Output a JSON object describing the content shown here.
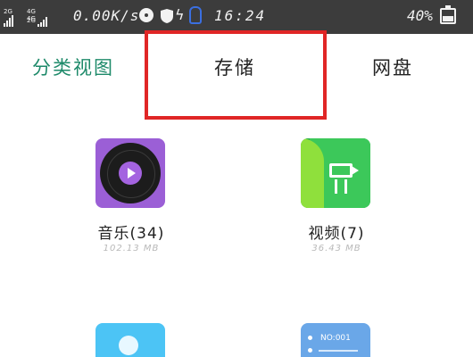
{
  "status_bar": {
    "network_1": "2G",
    "network_2a": "4G 4G",
    "network_2b": "2G",
    "speed": "0.00K/s",
    "time": "16:24",
    "battery": "40%"
  },
  "tabs": [
    {
      "label": "分类视图"
    },
    {
      "label": "存储"
    },
    {
      "label": "网盘"
    }
  ],
  "items": {
    "music": {
      "label": "音乐(34)",
      "size": "102.13 MB"
    },
    "video": {
      "label": "视频(7)",
      "size": "36.43 MB"
    },
    "document": {
      "badge": "NO:001"
    }
  },
  "colors": {
    "active_tab": "#1e8a6a",
    "highlight": "#e02626",
    "status_bar": "#3c3c3c",
    "music_icon": "#9b5fd6",
    "video_icon": "#2db04b"
  },
  "icons": [
    "signal-icon",
    "disc-icon",
    "shield-icon",
    "bolt-icon",
    "bell-icon",
    "battery-icon",
    "music-app-icon",
    "video-app-icon",
    "photo-app-icon",
    "document-app-icon"
  ]
}
